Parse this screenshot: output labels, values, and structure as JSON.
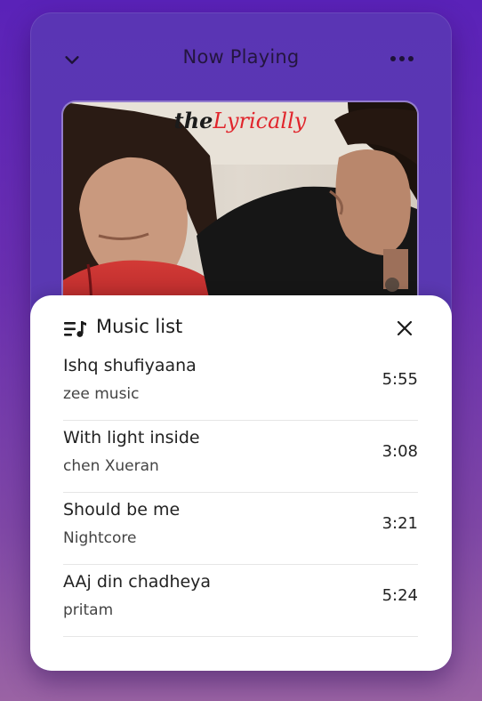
{
  "header": {
    "title": "Now Playing"
  },
  "cover": {
    "watermark_a": "the",
    "watermark_b": "Lyrically"
  },
  "music_list": {
    "title": "Music list",
    "songs": [
      {
        "title": "Ishq shufiyaana",
        "artist": "zee music",
        "duration": "5:55"
      },
      {
        "title": "With light inside",
        "artist": "chen Xueran",
        "duration": "3:08"
      },
      {
        "title": "Should be me",
        "artist": "Nightcore",
        "duration": "3:21"
      },
      {
        "title": "AAj din chadheya",
        "artist": "pritam",
        "duration": "5:24"
      }
    ]
  },
  "colors": {
    "accent": "#5a35b4",
    "background": "#6a2fb0",
    "panel": "#ffffff"
  },
  "icons": {
    "collapse": "chevron-down-icon",
    "menu": "more-horizontal-icon",
    "list": "playlist-icon",
    "close": "close-icon"
  }
}
